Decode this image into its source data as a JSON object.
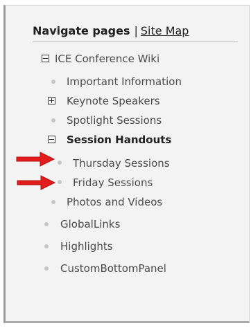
{
  "header": {
    "title": "Navigate pages",
    "separator": "|",
    "site_map_link": "Site Map"
  },
  "tree": {
    "root": {
      "label": "ICE Conference Wiki",
      "expand_state": "collapse-icon"
    },
    "children": [
      {
        "label": "Important Information",
        "marker": "bullet"
      },
      {
        "label": "Keynote Speakers",
        "marker": "expand-icon"
      },
      {
        "label": "Spotlight Sessions",
        "marker": "bullet"
      },
      {
        "label": "Session Handouts",
        "marker": "collapse-icon",
        "bold": true,
        "children": [
          {
            "label": "Thursday Sessions",
            "marker": "bullet",
            "annotated": "red-arrow-icon"
          },
          {
            "label": "Friday Sessions",
            "marker": "bullet",
            "annotated": "red-arrow-icon"
          }
        ]
      },
      {
        "label": "Photos and Videos",
        "marker": "bullet"
      }
    ]
  },
  "panels": [
    {
      "label": "GlobalLinks",
      "marker": "bullet"
    },
    {
      "label": "Highlights",
      "marker": "bullet"
    },
    {
      "label": "CustomBottomPanel",
      "marker": "bullet"
    }
  ],
  "colors": {
    "panel_background": "#f3f3f3",
    "text": "#4a4a4a",
    "bullet": "#c6c6c6",
    "arrow": "#e21b1b"
  }
}
